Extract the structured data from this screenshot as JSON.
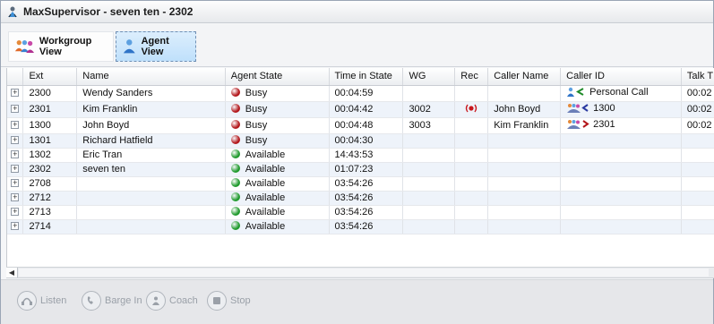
{
  "window": {
    "title": "MaxSupervisor - seven ten - 2302"
  },
  "views": {
    "workgroup": "Workgroup View",
    "agent": "Agent View"
  },
  "columns": [
    "Ext",
    "Name",
    "Agent State",
    "Time in State",
    "WG",
    "Rec",
    "Caller Name",
    "Caller ID",
    "Talk T"
  ],
  "rows": [
    {
      "ext": "2300",
      "name": "Wendy Sanders",
      "state": "Busy",
      "time": "00:04:59",
      "wg": "",
      "rec": false,
      "caller_name": "",
      "caller_id": "Personal Call",
      "cid_icon": "single-agent-inbound-icon",
      "talk": "00:02"
    },
    {
      "ext": "2301",
      "name": "Kim Franklin",
      "state": "Busy",
      "time": "00:04:42",
      "wg": "3002",
      "rec": true,
      "caller_name": "John Boyd",
      "caller_id": "1300",
      "cid_icon": "group-inbound-icon",
      "talk": "00:02"
    },
    {
      "ext": "1300",
      "name": "John Boyd",
      "state": "Busy",
      "time": "00:04:48",
      "wg": "3003",
      "rec": false,
      "caller_name": "Kim Franklin",
      "caller_id": "2301",
      "cid_icon": "group-outbound-icon",
      "talk": "00:02"
    },
    {
      "ext": "1301",
      "name": "Richard Hatfield",
      "state": "Busy",
      "time": "00:04:30",
      "wg": "",
      "rec": false,
      "caller_name": "",
      "caller_id": "",
      "cid_icon": "",
      "talk": ""
    },
    {
      "ext": "1302",
      "name": "Eric Tran",
      "state": "Available",
      "time": "14:43:53",
      "wg": "",
      "rec": false,
      "caller_name": "",
      "caller_id": "",
      "cid_icon": "",
      "talk": ""
    },
    {
      "ext": "2302",
      "name": "seven ten",
      "state": "Available",
      "time": "01:07:23",
      "wg": "",
      "rec": false,
      "caller_name": "",
      "caller_id": "",
      "cid_icon": "",
      "talk": ""
    },
    {
      "ext": "2708",
      "name": "",
      "state": "Available",
      "time": "03:54:26",
      "wg": "",
      "rec": false,
      "caller_name": "",
      "caller_id": "",
      "cid_icon": "",
      "talk": ""
    },
    {
      "ext": "2712",
      "name": "",
      "state": "Available",
      "time": "03:54:26",
      "wg": "",
      "rec": false,
      "caller_name": "",
      "caller_id": "",
      "cid_icon": "",
      "talk": ""
    },
    {
      "ext": "2713",
      "name": "",
      "state": "Available",
      "time": "03:54:26",
      "wg": "",
      "rec": false,
      "caller_name": "",
      "caller_id": "",
      "cid_icon": "",
      "talk": ""
    },
    {
      "ext": "2714",
      "name": "",
      "state": "Available",
      "time": "03:54:26",
      "wg": "",
      "rec": false,
      "caller_name": "",
      "caller_id": "",
      "cid_icon": "",
      "talk": ""
    }
  ],
  "colors": {
    "busy": "#b3171b",
    "available": "#1f9a2c",
    "rec": "#c8161c",
    "selected_view": "#bfe0fb"
  },
  "actions": [
    {
      "id": "listen",
      "label": "Listen",
      "icon": "listen-icon"
    },
    {
      "id": "barge-in",
      "label": "Barge In",
      "icon": "barge-in-icon"
    },
    {
      "id": "coach",
      "label": "Coach",
      "icon": "coach-icon"
    },
    {
      "id": "stop",
      "label": "Stop",
      "icon": "stop-icon"
    }
  ]
}
